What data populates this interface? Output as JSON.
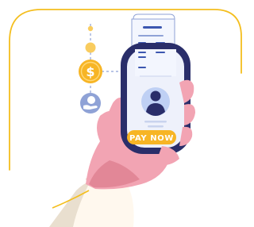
{
  "illustration": {
    "pay_button_label": "PAY NOW",
    "currency_symbol": "$",
    "receipt_symbol": "$",
    "icon_names": [
      "dollar-coin-icon",
      "hand-coin-icon",
      "receipt-icon",
      "user-avatar-icon"
    ],
    "colors": {
      "frame": "#F4BE1E",
      "coin": "#F7B525",
      "coin_dot": "#F9CC5E",
      "phone_body": "#2A2E6A",
      "phone_screen": "#EEF1FB",
      "avatar_bg": "#BFD0F4",
      "avatar_fg": "#2A2E6A",
      "pay_button": "#F7B525",
      "hand": "#F2A4B3",
      "hand_shadow": "#E28797",
      "sleeve": "#FFF8EE",
      "sleeve_shadow": "#E9DFCF",
      "hand_coin_circle": "#8FA2D6",
      "dashed_line": "#8FA2D6"
    }
  }
}
